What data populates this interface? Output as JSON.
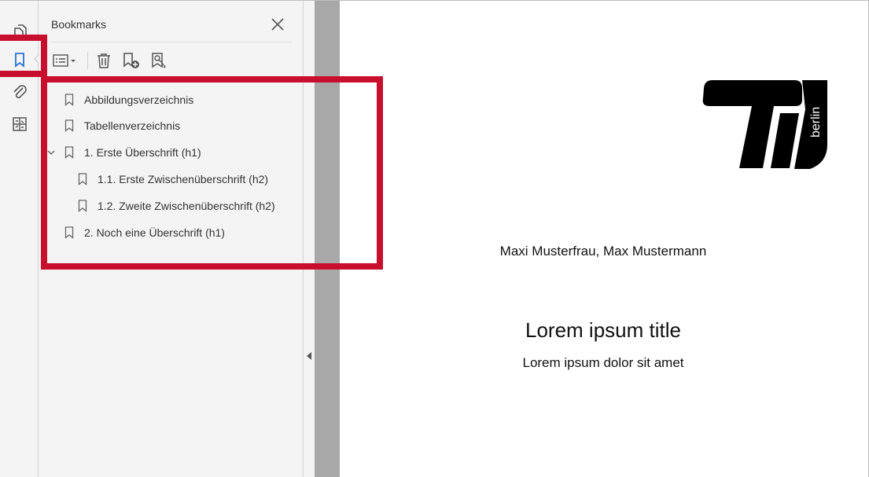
{
  "panel": {
    "title": "Bookmarks",
    "bookmarks": [
      {
        "label": "Abbildungsverzeichnis"
      },
      {
        "label": "Tabellenverzeichnis"
      },
      {
        "label": "1. Erste Überschrift (h1)"
      },
      {
        "label": "1.1. Erste Zwischenüberschrift (h2)"
      },
      {
        "label": "1.2. Zweite Zwischenüberschrift (h2)"
      },
      {
        "label": "2. Noch eine Überschrift (h1)"
      }
    ]
  },
  "document": {
    "logo_text": "berlin",
    "authors": "Maxi Musterfrau, Max Mustermann",
    "title": "Lorem ipsum title",
    "subtitle": "Lorem ipsum dolor sit amet"
  },
  "colors": {
    "highlight": "#c8102e",
    "accent": "#2a74d4",
    "panel_bg": "#f4f4f4"
  },
  "icons": [
    "pages-icon",
    "bookmark-icon",
    "attachment-icon",
    "compare-icon",
    "options-icon",
    "delete-icon",
    "new-bookmark-icon",
    "find-bookmark-icon",
    "close-icon",
    "expand-chevron-icon",
    "collapse-panel-icon"
  ]
}
